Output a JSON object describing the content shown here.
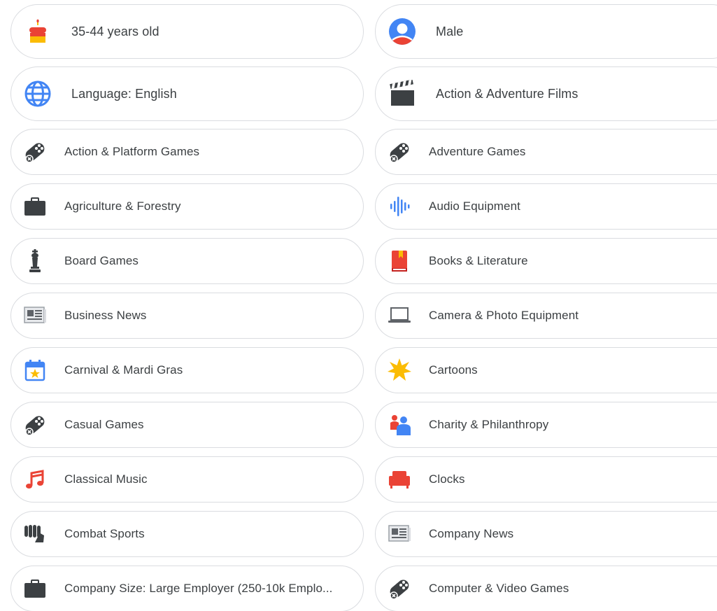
{
  "chips_left": [
    {
      "label": "35-44 years old",
      "icon": "birthday-cake-icon"
    },
    {
      "label": "Language: English",
      "icon": "globe-icon"
    },
    {
      "label": "Action & Platform Games",
      "icon": "gamepad-icon"
    },
    {
      "label": "Agriculture & Forestry",
      "icon": "briefcase-icon"
    },
    {
      "label": "Board Games",
      "icon": "chess-piece-icon"
    },
    {
      "label": "Business News",
      "icon": "newspaper-icon"
    },
    {
      "label": "Carnival & Mardi Gras",
      "icon": "calendar-star-icon"
    },
    {
      "label": "Casual Games",
      "icon": "gamepad-icon"
    },
    {
      "label": "Classical Music",
      "icon": "music-note-icon"
    },
    {
      "label": "Combat Sports",
      "icon": "fist-icon"
    },
    {
      "label": "Company Size: Large Employer (250-10k Emplo...",
      "icon": "briefcase-icon"
    }
  ],
  "chips_right": [
    {
      "label": "Male",
      "icon": "person-icon"
    },
    {
      "label": "Action & Adventure Films",
      "icon": "clapperboard-icon"
    },
    {
      "label": "Adventure Games",
      "icon": "gamepad-icon"
    },
    {
      "label": "Audio Equipment",
      "icon": "audio-wave-icon"
    },
    {
      "label": "Books & Literature",
      "icon": "book-icon"
    },
    {
      "label": "Camera & Photo Equipment",
      "icon": "laptop-icon"
    },
    {
      "label": "Cartoons",
      "icon": "star-burst-icon"
    },
    {
      "label": "Charity & Philanthropy",
      "icon": "people-icon"
    },
    {
      "label": "Clocks",
      "icon": "armchair-icon"
    },
    {
      "label": "Company News",
      "icon": "newspaper-icon"
    },
    {
      "label": "Computer & Video Games",
      "icon": "gamepad-icon"
    }
  ],
  "colors": {
    "border": "#dadce0",
    "text": "#3c4043",
    "icon_dark": "#3c4043",
    "google_blue": "#4285f4",
    "google_red": "#ea4335",
    "google_yellow": "#fbbc04",
    "google_green": "#34a853"
  }
}
